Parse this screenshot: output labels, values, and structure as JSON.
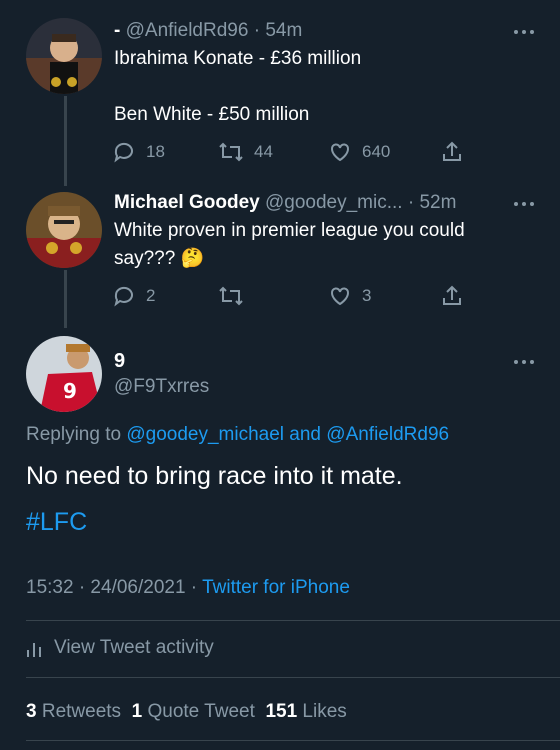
{
  "tweets": [
    {
      "display_name": "-",
      "handle": "@AnfieldRd96",
      "time": "54m",
      "text_line1": "Ibrahima Konate - £36 million",
      "text_line2": "Ben White - £50 million",
      "replies": "18",
      "retweets": "44",
      "likes": "640"
    },
    {
      "display_name": "Michael Goodey",
      "handle": "@goodey_mic...",
      "time": "52m",
      "text_line1": "White proven in premier league you could",
      "text_line2": "say???",
      "emoji": "🤔",
      "replies": "2",
      "retweets": "",
      "likes": "3"
    }
  ],
  "main_tweet": {
    "display_name": "9",
    "handle": "@F9Txrres",
    "avatar_number": "9",
    "replying_prefix": "Replying to",
    "replying_user1": "@goodey_michael",
    "replying_and": "and",
    "replying_user2": "@AnfieldRd96",
    "text": "No need to bring race into it mate.",
    "hashtag": "#LFC",
    "timestamp": "15:32 · 24/06/2021 ·",
    "source": "Twitter for iPhone",
    "activity_label": "View Tweet activity",
    "retweets_count": "3",
    "retweets_label": "Retweets",
    "quote_count": "1",
    "quote_label": "Quote Tweet",
    "likes_count": "151",
    "likes_label": "Likes"
  },
  "colors": {
    "background": "#15202b",
    "muted": "#8899a6",
    "link": "#1d9bf0",
    "divider": "#38444d"
  }
}
